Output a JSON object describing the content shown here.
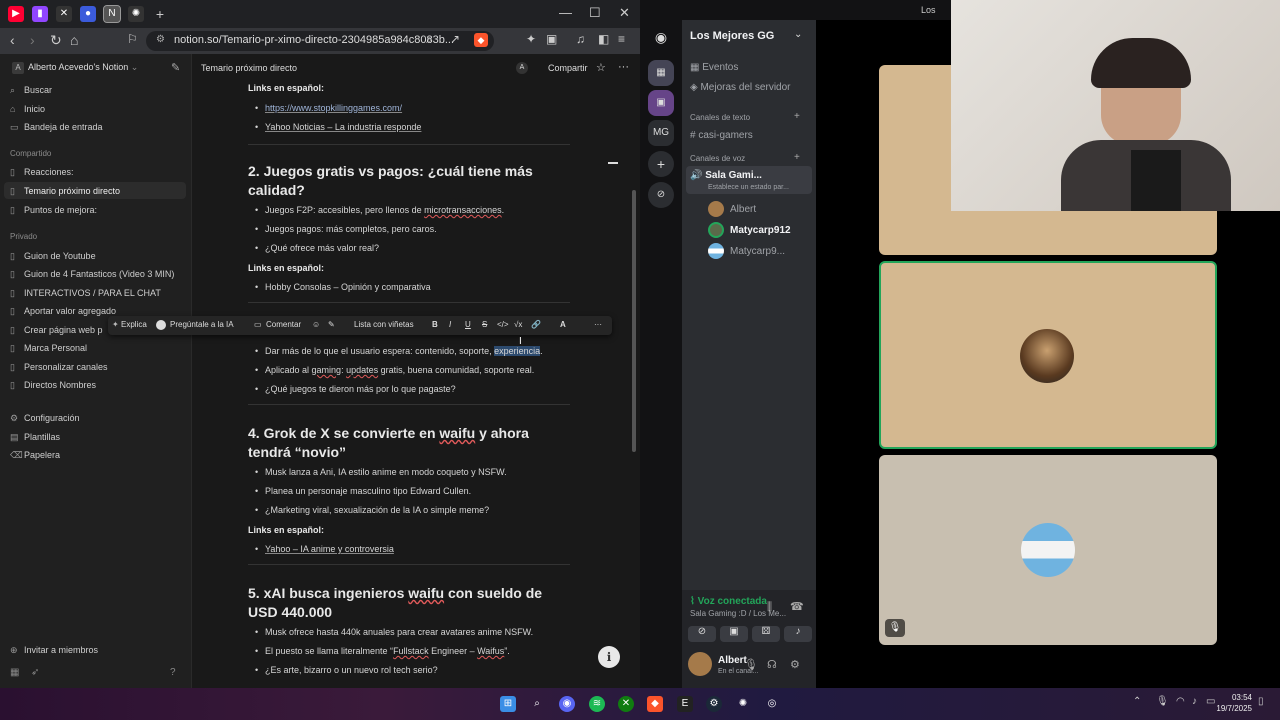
{
  "browser": {
    "url": "notion.so/Temario-pr-ximo-directo-2304985a984c8083b...",
    "tabs": [
      {
        "color": "#ff0033"
      },
      {
        "color": "#9146ff"
      },
      {
        "color": "#444"
      },
      {
        "color": "#3b5bdb"
      },
      {
        "color": "#555"
      },
      {
        "color": "#444"
      }
    ],
    "tab_add": "+"
  },
  "sidebar": {
    "workspace": "Alberto Acevedo's Notion",
    "top_items": [
      {
        "icon": "⌕",
        "label": "Buscar"
      },
      {
        "icon": "⌂",
        "label": "Inicio"
      },
      {
        "icon": "▭",
        "label": "Bandeja de entrada"
      }
    ],
    "shared_head": "Compartido",
    "shared": [
      {
        "label": "Reacciones:"
      },
      {
        "label": "Temario próximo directo"
      },
      {
        "label": "Puntos de mejora:"
      }
    ],
    "private_head": "Privado",
    "private": [
      {
        "label": "Guion de Youtube"
      },
      {
        "label": "Guion de 4 Fantasticos (Video 3 MIN)"
      },
      {
        "label": "INTERACTIVOS / PARA EL CHAT"
      },
      {
        "label": "Aportar valor agregado"
      },
      {
        "label": "Crear página web p"
      },
      {
        "label": "Marca Personal"
      },
      {
        "label": "Personalizar canales"
      },
      {
        "label": "Directos Nombres"
      }
    ],
    "bottom": [
      {
        "icon": "⚙",
        "label": "Configuración"
      },
      {
        "icon": "▤",
        "label": "Plantillas"
      },
      {
        "icon": "🗑",
        "label": "Papelera"
      }
    ],
    "invite": "Invitar a miembros"
  },
  "page": {
    "crumb": "Temario próximo directo",
    "share": "Compartir",
    "avatar": "A",
    "links_label": "Links en español:",
    "link1": "https://www.stopkillinggames.com/",
    "link2": "Yahoo Noticias – La industria responde",
    "h2": "2. Juegos gratis vs pagos: ¿cuál tiene más calidad?",
    "s2b1a": "Juegos F2P: accesibles, pero llenos de ",
    "s2b1b": "microtransacciones",
    "s2b1c": ".",
    "s2b2": "Juegos pagos: más completos, pero caros.",
    "s2b3": "¿Qué ofrece más valor real?",
    "s2link": "Hobby Consolas – Opinión y comparativa",
    "s3b1a": "Dar más de lo que el usuario espera: contenido, soporte, ",
    "s3b1b": "experiencia",
    "s3b1c": ".",
    "s3b2a": "Aplicado al ",
    "s3b2b": "gaming",
    "s3b2c": ": ",
    "s3b2d": "updates",
    "s3b2e": " gratis, buena comunidad, soporte real.",
    "s3b3": "¿Qué juegos te dieron más por lo que pagaste?",
    "h4a": "4. Grok de X se convierte en ",
    "h4b": "waifu",
    "h4c": " y ahora tendrá “novio”",
    "s4b1": "Musk lanza a Ani, IA estilo anime en modo coqueto y NSFW.",
    "s4b2": "Planea un personaje masculino tipo Edward Cullen.",
    "s4b3": "¿Marketing viral, sexualización de la IA o simple meme?",
    "s4link": "Yahoo – IA anime y controversia",
    "h5a": "5. xAI busca ingenieros ",
    "h5b": "waifu",
    "h5c": " con sueldo de USD 440.000",
    "s5b1": "Musk ofrece hasta 440k anuales para crear avatares anime NSFW.",
    "s5b2a": "El puesto se llama literalmente “",
    "s5b2b": "Fullstack",
    "s5b2c": " Engineer – ",
    "s5b2d": "Waifus",
    "s5b2e": "”.",
    "s5b3": "¿Es arte, bizarro o un nuevo rol tech serio?"
  },
  "toolbar": {
    "explica": "Explica",
    "ask": "Pregúntale a la IA",
    "comment": "Comentar",
    "list": "Lista con viñetas",
    "bold": "B",
    "italic": "I",
    "underline": "U",
    "strike": "S",
    "code": "</>",
    "math": "√x",
    "link": "🔗",
    "color": "A",
    "more": "···"
  },
  "discord": {
    "server": "Los Mejores GG",
    "events": "Eventos",
    "boosts": "Mejoras del servidor",
    "text_head": "Canales de texto",
    "text_channel": "casi-gamers",
    "voice_head": "Canales de voz",
    "voice_channel": "Sala Gami...",
    "voice_status": "Establece un estado par...",
    "members": [
      {
        "name": "Albert"
      },
      {
        "name": "Matycarp912"
      },
      {
        "name": "Matycarp9..."
      }
    ],
    "connected": "Voz conectada",
    "connected_sub": "Sala Gaming :D / Los Me...",
    "user": "Albert",
    "user_status": "En el canal...",
    "top_title": "Los",
    "server_icons": [
      "MG",
      "+",
      "⊘"
    ]
  },
  "taskbar": {
    "time": "03:54",
    "date": "19/7/2025"
  }
}
